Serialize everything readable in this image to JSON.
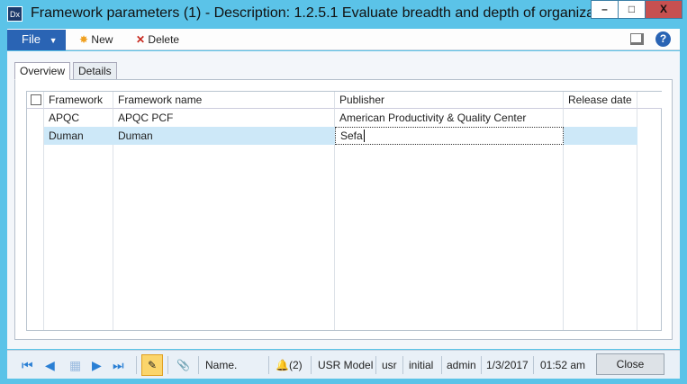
{
  "window": {
    "title": "Framework parameters (1) - Description: 1.2.5.1  Evaluate breadth and depth of organization...",
    "minimize": "–",
    "maximize": "□",
    "close": "X"
  },
  "toolbar": {
    "file": "File",
    "new": "New",
    "delete": "Delete"
  },
  "tabs": [
    {
      "label": "Overview",
      "active": true
    },
    {
      "label": "Details"
    }
  ],
  "grid": {
    "columns": [
      "Framework",
      "Framework name",
      "Publisher",
      "Release date"
    ],
    "rows": [
      [
        "APQC",
        "APQC PCF",
        "American Productivity & Quality Center",
        ""
      ],
      [
        "Duman",
        "Duman",
        "Sefa",
        ""
      ]
    ],
    "selected_row": 1
  },
  "status": {
    "name": "Name.",
    "notifications": "(2)",
    "model": "USR Model",
    "company": "usr",
    "layer": "initial",
    "user": "admin",
    "date": "1/3/2017",
    "time": "01:52 am",
    "close": "Close"
  },
  "colors": {
    "accent": "#2a64b4",
    "border": "#5bc3e8",
    "selected": "#cde8f8"
  }
}
